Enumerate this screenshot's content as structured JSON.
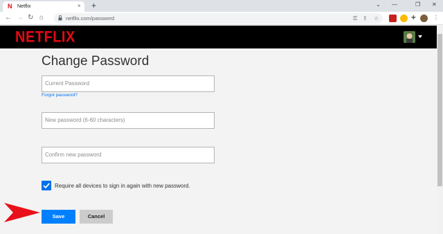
{
  "browser": {
    "tab_title": "Netflix",
    "tab_favicon": "N",
    "tab_close": "×",
    "new_tab": "+",
    "url": "netflix.com/password"
  },
  "header": {
    "brand": "NETFLIX",
    "brand_color": "#e50914"
  },
  "page": {
    "title": "Change Password",
    "current_password_placeholder": "Current Password",
    "forgot_link": "Forgot password?",
    "new_password_placeholder": "New password (6-60 characters)",
    "confirm_password_placeholder": "Confirm new password",
    "checkbox_label": "Require all devices to sign in again with new password.",
    "checkbox_checked": true,
    "save_label": "Save",
    "cancel_label": "Cancel"
  },
  "colors": {
    "accent": "#0080ff",
    "link": "#0071eb",
    "annotation_arrow": "#e8101a"
  }
}
